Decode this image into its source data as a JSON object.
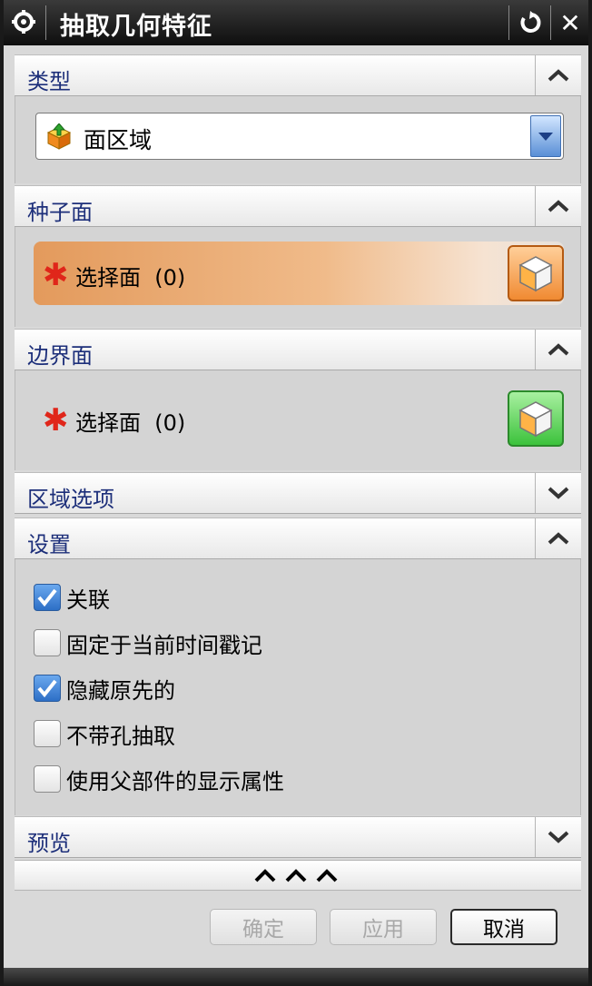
{
  "window": {
    "title": "抽取几何特征"
  },
  "sections": {
    "type": {
      "title": "类型",
      "expanded": true
    },
    "seed_face": {
      "title": "种子面",
      "expanded": true
    },
    "boundary_face": {
      "title": "边界面",
      "expanded": true
    },
    "region_options": {
      "title": "区域选项",
      "expanded": false
    },
    "settings": {
      "title": "设置",
      "expanded": true
    },
    "preview": {
      "title": "预览",
      "expanded": false
    }
  },
  "type_dropdown": {
    "value": "面区域"
  },
  "seed_select": {
    "label": "选择面",
    "count": "(0)"
  },
  "boundary_select": {
    "label": "选择面",
    "count": "(0)"
  },
  "settings_options": [
    {
      "label": "关联",
      "checked": true
    },
    {
      "label": "固定于当前时间戳记",
      "checked": false
    },
    {
      "label": "隐藏原先的",
      "checked": true
    },
    {
      "label": "不带孔抽取",
      "checked": false
    },
    {
      "label": "使用父部件的显示属性",
      "checked": false
    }
  ],
  "buttons": {
    "ok": "确定",
    "apply": "应用",
    "cancel": "取消"
  },
  "icons": {
    "title_menu": "gear-icon",
    "reset": "reset-icon",
    "close": "close-icon",
    "expand": "chevron-up-icon",
    "collapse": "chevron-down-icon",
    "more": "triple-chevron-up-icon"
  },
  "colors": {
    "section_title": "#1d2f7a",
    "active_select": "#e39a5c",
    "required_star": "#e0261a"
  }
}
